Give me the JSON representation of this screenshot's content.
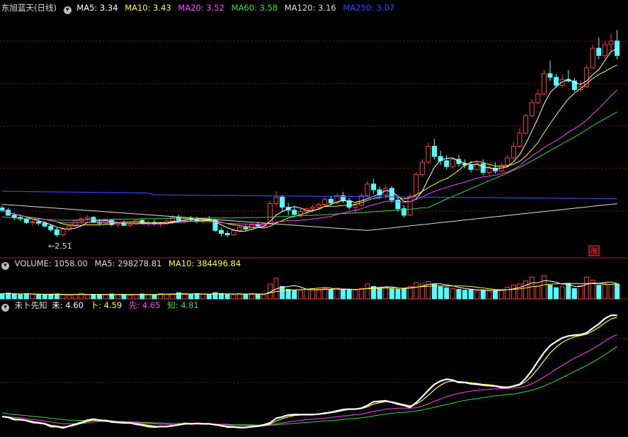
{
  "colors": {
    "up": "#ff3b3b",
    "down": "#54ffff",
    "ma5": "#ffffff",
    "ma10": "#ffff33",
    "ma20": "#ff44ff",
    "ma60": "#33dd33",
    "ma120": "#dddddd",
    "ma250": "#3344ff",
    "grid": "#8a1010"
  },
  "price_panel": {
    "title": "东旭蓝天(日线)",
    "ma_labels": {
      "ma5": "MA5: 3.34",
      "ma10": "MA10: 3.43",
      "ma20": "MA20: 3.52",
      "ma60": "MA60: 3.58",
      "ma120": "MA120: 3.16",
      "ma250": "MA250: 3.07"
    },
    "low_marker": "←2.51",
    "corner_badge": "涨"
  },
  "volume_panel": {
    "labels": {
      "volume": "VOLUME: 1058.00",
      "ma5": "MA5: 298278.81",
      "ma10": "MA10: 384496.84"
    }
  },
  "indicator_panel": {
    "labels": {
      "name": "未卜先知",
      "wei": "未: 4.60",
      "bu": "卜: 4.59",
      "xian": "先: 4.65",
      "zhi": "知: 4.81"
    }
  },
  "chart_data": [
    {
      "type": "candlestick",
      "title": "东旭蓝天(日线)",
      "ylim": [
        2.4,
        5.6
      ],
      "candles": [
        [
          2.95,
          2.98,
          2.89,
          2.92
        ],
        [
          2.92,
          2.95,
          2.84,
          2.85
        ],
        [
          2.85,
          2.89,
          2.78,
          2.82
        ],
        [
          2.82,
          2.86,
          2.77,
          2.8
        ],
        [
          2.8,
          2.83,
          2.73,
          2.75
        ],
        [
          2.75,
          2.79,
          2.7,
          2.76
        ],
        [
          2.76,
          2.8,
          2.71,
          2.74
        ],
        [
          2.74,
          2.77,
          2.68,
          2.7
        ],
        [
          2.7,
          2.73,
          2.62,
          2.65
        ],
        [
          2.65,
          2.68,
          2.55,
          2.58
        ],
        [
          2.58,
          2.68,
          2.56,
          2.66
        ],
        [
          2.66,
          2.72,
          2.63,
          2.7
        ],
        [
          2.7,
          2.79,
          2.69,
          2.77
        ],
        [
          2.77,
          2.83,
          2.73,
          2.8
        ],
        [
          2.8,
          2.85,
          2.77,
          2.82
        ],
        [
          2.82,
          2.84,
          2.74,
          2.75
        ],
        [
          2.75,
          2.79,
          2.71,
          2.74
        ],
        [
          2.74,
          2.8,
          2.72,
          2.78
        ],
        [
          2.78,
          2.8,
          2.7,
          2.72
        ],
        [
          2.72,
          2.76,
          2.68,
          2.74
        ],
        [
          2.74,
          2.78,
          2.7,
          2.71
        ],
        [
          2.71,
          2.75,
          2.69,
          2.73
        ],
        [
          2.73,
          2.8,
          2.72,
          2.78
        ],
        [
          2.78,
          2.81,
          2.72,
          2.74
        ],
        [
          2.74,
          2.78,
          2.7,
          2.75
        ],
        [
          2.75,
          2.79,
          2.71,
          2.73
        ],
        [
          2.73,
          2.76,
          2.69,
          2.74
        ],
        [
          2.74,
          2.79,
          2.72,
          2.77
        ],
        [
          2.77,
          2.85,
          2.75,
          2.82
        ],
        [
          2.82,
          2.86,
          2.76,
          2.78
        ],
        [
          2.78,
          2.82,
          2.74,
          2.8
        ],
        [
          2.8,
          2.84,
          2.77,
          2.79
        ],
        [
          2.79,
          2.83,
          2.74,
          2.77
        ],
        [
          2.77,
          2.81,
          2.73,
          2.79
        ],
        [
          2.79,
          2.84,
          2.76,
          2.78
        ],
        [
          2.78,
          2.8,
          2.62,
          2.64
        ],
        [
          2.64,
          2.68,
          2.56,
          2.6
        ],
        [
          2.6,
          2.64,
          2.55,
          2.58
        ],
        [
          2.58,
          2.66,
          2.57,
          2.64
        ],
        [
          2.64,
          2.7,
          2.62,
          2.68
        ],
        [
          2.68,
          2.72,
          2.63,
          2.66
        ],
        [
          2.66,
          2.74,
          2.65,
          2.72
        ],
        [
          2.72,
          2.76,
          2.68,
          2.7
        ],
        [
          2.7,
          2.74,
          2.67,
          2.73
        ],
        [
          2.73,
          3.05,
          2.72,
          3.01
        ],
        [
          3.01,
          3.18,
          2.96,
          3.1
        ],
        [
          3.1,
          3.13,
          2.9,
          2.96
        ],
        [
          2.96,
          3.02,
          2.85,
          2.92
        ],
        [
          2.92,
          2.98,
          2.82,
          2.86
        ],
        [
          2.86,
          2.94,
          2.82,
          2.9
        ],
        [
          2.9,
          2.96,
          2.85,
          2.94
        ],
        [
          2.94,
          2.99,
          2.9,
          2.96
        ],
        [
          2.96,
          3.02,
          2.93,
          3.0
        ],
        [
          3.0,
          3.1,
          2.98,
          3.07
        ],
        [
          3.07,
          3.12,
          2.99,
          3.02
        ],
        [
          3.02,
          3.15,
          3.0,
          3.12
        ],
        [
          3.12,
          3.17,
          3.02,
          3.05
        ],
        [
          3.05,
          3.09,
          2.92,
          2.96
        ],
        [
          2.96,
          3.02,
          2.88,
          2.99
        ],
        [
          2.99,
          3.15,
          2.97,
          3.12
        ],
        [
          3.12,
          3.32,
          3.1,
          3.28
        ],
        [
          3.28,
          3.35,
          3.14,
          3.2
        ],
        [
          3.2,
          3.24,
          3.08,
          3.13
        ],
        [
          3.13,
          3.26,
          3.08,
          3.22
        ],
        [
          3.22,
          3.25,
          3.02,
          3.06
        ],
        [
          3.06,
          3.09,
          2.9,
          2.94
        ],
        [
          2.94,
          2.99,
          2.82,
          2.85
        ],
        [
          2.85,
          3.15,
          2.84,
          3.11
        ],
        [
          3.11,
          3.45,
          3.09,
          3.41
        ],
        [
          3.41,
          3.62,
          3.38,
          3.58
        ],
        [
          3.58,
          3.85,
          3.56,
          3.8
        ],
        [
          3.8,
          3.9,
          3.62,
          3.66
        ],
        [
          3.66,
          3.74,
          3.54,
          3.6
        ],
        [
          3.6,
          3.68,
          3.48,
          3.52
        ],
        [
          3.52,
          3.64,
          3.5,
          3.62
        ],
        [
          3.62,
          3.68,
          3.52,
          3.56
        ],
        [
          3.56,
          3.62,
          3.5,
          3.54
        ],
        [
          3.54,
          3.6,
          3.44,
          3.48
        ],
        [
          3.48,
          3.6,
          3.46,
          3.56
        ],
        [
          3.56,
          3.62,
          3.4,
          3.44
        ],
        [
          3.44,
          3.56,
          3.4,
          3.5
        ],
        [
          3.5,
          3.58,
          3.42,
          3.46
        ],
        [
          3.46,
          3.58,
          3.44,
          3.54
        ],
        [
          3.54,
          3.68,
          3.52,
          3.64
        ],
        [
          3.64,
          3.85,
          3.62,
          3.8
        ],
        [
          3.8,
          4.05,
          3.78,
          3.98
        ],
        [
          3.98,
          4.25,
          3.96,
          4.22
        ],
        [
          4.22,
          4.45,
          4.2,
          4.4
        ],
        [
          4.4,
          4.58,
          4.38,
          4.52
        ],
        [
          4.52,
          4.85,
          4.5,
          4.8
        ],
        [
          4.8,
          4.98,
          4.7,
          4.75
        ],
        [
          4.75,
          4.8,
          4.6,
          4.64
        ],
        [
          4.64,
          4.78,
          4.6,
          4.72
        ],
        [
          4.72,
          4.85,
          4.68,
          4.7
        ],
        [
          4.7,
          4.74,
          4.55,
          4.58
        ],
        [
          4.58,
          4.7,
          4.55,
          4.62
        ],
        [
          4.62,
          4.92,
          4.6,
          4.88
        ],
        [
          4.88,
          5.2,
          4.86,
          5.15
        ],
        [
          5.15,
          5.3,
          5.0,
          5.05
        ],
        [
          5.05,
          5.25,
          5.0,
          5.2
        ],
        [
          5.2,
          5.35,
          5.1,
          5.25
        ],
        [
          5.25,
          5.4,
          5.0,
          5.05
        ]
      ]
    },
    {
      "type": "bar",
      "title": "VOLUME",
      "ylim": [
        0,
        1.5
      ],
      "values": [
        0.25,
        0.28,
        0.22,
        0.2,
        0.26,
        0.22,
        0.2,
        0.18,
        0.22,
        0.24,
        0.2,
        0.18,
        0.22,
        0.26,
        0.2,
        0.22,
        0.18,
        0.2,
        0.24,
        0.2,
        0.22,
        0.18,
        0.2,
        0.24,
        0.22,
        0.2,
        0.26,
        0.22,
        0.24,
        0.3,
        0.22,
        0.2,
        0.26,
        0.22,
        0.2,
        0.3,
        0.26,
        0.22,
        0.2,
        0.24,
        0.22,
        0.26,
        0.22,
        0.2,
        0.72,
        1.0,
        0.6,
        0.46,
        0.42,
        0.4,
        0.44,
        0.48,
        0.46,
        0.5,
        0.44,
        0.52,
        0.46,
        0.44,
        0.42,
        0.5,
        0.72,
        0.6,
        0.52,
        0.56,
        0.48,
        0.46,
        0.5,
        0.6,
        0.78,
        0.72,
        0.84,
        0.7,
        0.58,
        0.54,
        0.5,
        0.46,
        0.42,
        0.44,
        0.4,
        0.42,
        0.38,
        0.4,
        0.44,
        0.56,
        0.66,
        0.72,
        0.86,
        1.05,
        0.62,
        1.12,
        0.66,
        0.54,
        0.58,
        0.72,
        0.5,
        0.64,
        1.05,
        0.9,
        0.66,
        0.74,
        0.7,
        0.72
      ]
    },
    {
      "type": "line",
      "title": "未卜先知",
      "ylim": [
        2.5,
        5.15
      ],
      "series": [
        {
          "name": "未",
          "values": [
            2.87,
            2.85,
            2.8,
            2.8,
            2.78,
            2.74,
            2.73,
            2.71,
            2.65,
            2.65,
            2.62,
            2.66,
            2.7,
            2.74,
            2.79,
            2.81,
            2.79,
            2.78,
            2.75,
            2.74,
            2.73,
            2.73,
            2.7,
            2.68,
            2.65,
            2.64,
            2.65,
            2.65,
            2.67,
            2.69,
            2.72,
            2.71,
            2.72,
            2.71,
            2.71,
            2.69,
            2.67,
            2.64,
            2.64,
            2.63,
            2.63,
            2.65,
            2.66,
            2.69,
            2.73,
            2.83,
            2.86,
            2.9,
            2.91,
            2.91,
            2.91,
            2.91,
            2.92,
            2.94,
            2.96,
            2.99,
            3.02,
            3.03,
            3.03,
            3.05,
            3.11,
            3.19,
            3.2,
            3.21,
            3.18,
            3.14,
            3.11,
            3.07,
            3.17,
            3.3,
            3.44,
            3.57,
            3.64,
            3.68,
            3.66,
            3.61,
            3.61,
            3.58,
            3.57,
            3.55,
            3.54,
            3.53,
            3.5,
            3.5,
            3.53,
            3.57,
            3.7,
            3.87,
            4.07,
            4.26,
            4.41,
            4.5,
            4.58,
            4.62,
            4.64,
            4.65,
            4.69,
            4.79,
            4.88,
            5.0,
            5.07,
            5.07
          ]
        },
        {
          "name": "卜",
          "values": [
            2.87,
            2.86,
            2.82,
            2.81,
            2.79,
            2.76,
            2.74,
            2.72,
            2.68,
            2.66,
            2.64,
            2.65,
            2.68,
            2.72,
            2.76,
            2.79,
            2.79,
            2.79,
            2.77,
            2.75,
            2.74,
            2.73,
            2.72,
            2.7,
            2.68,
            2.66,
            2.65,
            2.65,
            2.66,
            2.68,
            2.7,
            2.71,
            2.72,
            2.71,
            2.71,
            2.7,
            2.68,
            2.66,
            2.65,
            2.64,
            2.63,
            2.64,
            2.65,
            2.67,
            2.7,
            2.77,
            2.82,
            2.86,
            2.89,
            2.9,
            2.91,
            2.91,
            2.92,
            2.93,
            2.95,
            2.97,
            3.0,
            3.02,
            3.03,
            3.04,
            3.08,
            3.14,
            3.17,
            3.19,
            3.19,
            3.16,
            3.13,
            3.1,
            3.14,
            3.22,
            3.33,
            3.45,
            3.55,
            3.62,
            3.64,
            3.63,
            3.62,
            3.6,
            3.59,
            3.57,
            3.56,
            3.54,
            3.52,
            3.51,
            3.52,
            3.55,
            3.63,
            3.75,
            3.91,
            4.08,
            4.25,
            4.38,
            4.48,
            4.55,
            4.6,
            4.63,
            4.66,
            4.73,
            4.81,
            4.91,
            4.99,
            5.03
          ]
        },
        {
          "name": "先",
          "values": [
            2.87,
            2.86,
            2.85,
            2.84,
            2.82,
            2.8,
            2.79,
            2.77,
            2.75,
            2.73,
            2.71,
            2.71,
            2.71,
            2.72,
            2.73,
            2.75,
            2.76,
            2.76,
            2.76,
            2.76,
            2.76,
            2.75,
            2.74,
            2.73,
            2.72,
            2.71,
            2.7,
            2.7,
            2.69,
            2.69,
            2.7,
            2.7,
            2.7,
            2.7,
            2.7,
            2.7,
            2.7,
            2.69,
            2.68,
            2.68,
            2.67,
            2.67,
            2.67,
            2.67,
            2.68,
            2.71,
            2.73,
            2.75,
            2.77,
            2.78,
            2.8,
            2.81,
            2.82,
            2.83,
            2.85,
            2.86,
            2.88,
            2.89,
            2.91,
            2.92,
            2.95,
            2.98,
            3.0,
            3.03,
            3.04,
            3.05,
            3.05,
            3.05,
            3.06,
            3.1,
            3.14,
            3.2,
            3.25,
            3.3,
            3.34,
            3.37,
            3.4,
            3.42,
            3.44,
            3.45,
            3.46,
            3.47,
            3.47,
            3.48,
            3.49,
            3.5,
            3.53,
            3.58,
            3.65,
            3.73,
            3.81,
            3.9,
            3.98,
            4.06,
            4.14,
            4.2,
            4.27,
            4.34,
            4.42,
            4.51,
            4.59,
            4.65
          ]
        },
        {
          "name": "知",
          "values": [
            2.95,
            2.93,
            2.91,
            2.9,
            2.89,
            2.87,
            2.86,
            2.85,
            2.83,
            2.82,
            2.8,
            2.79,
            2.79,
            2.78,
            2.78,
            2.78,
            2.77,
            2.77,
            2.77,
            2.76,
            2.76,
            2.75,
            2.75,
            2.74,
            2.74,
            2.73,
            2.73,
            2.72,
            2.72,
            2.72,
            2.71,
            2.71,
            2.71,
            2.71,
            2.71,
            2.7,
            2.7,
            2.7,
            2.69,
            2.69,
            2.69,
            2.69,
            2.68,
            2.68,
            2.68,
            2.69,
            2.7,
            2.71,
            2.72,
            2.73,
            2.74,
            2.75,
            2.76,
            2.77,
            2.78,
            2.79,
            2.8,
            2.82,
            2.83,
            2.84,
            2.86,
            2.88,
            2.9,
            2.92,
            2.94,
            2.95,
            2.96,
            2.97,
            2.99,
            3.01,
            3.04,
            3.07,
            3.1,
            3.13,
            3.16,
            3.19,
            3.22,
            3.24,
            3.26,
            3.28,
            3.3,
            3.32,
            3.33,
            3.35,
            3.36,
            3.38,
            3.41,
            3.44,
            3.48,
            3.53,
            3.59,
            3.65,
            3.71,
            3.78,
            3.85,
            3.91,
            3.98,
            4.05,
            4.13,
            4.21,
            4.3,
            4.39
          ]
        }
      ]
    }
  ]
}
